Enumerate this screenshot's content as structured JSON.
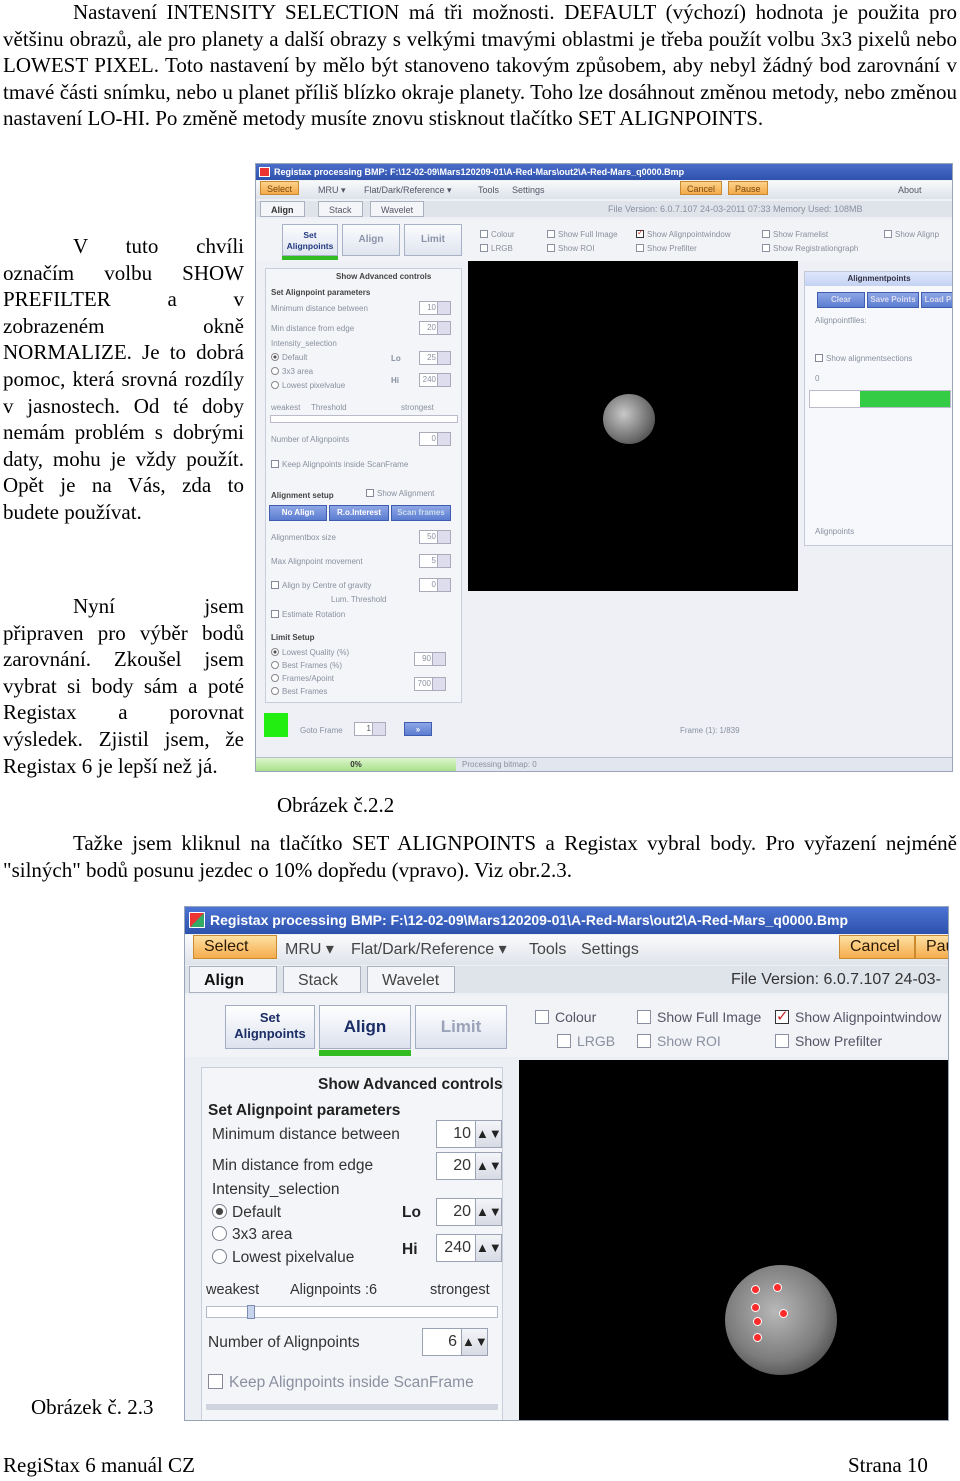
{
  "document": {
    "para1": "Nastavení INTENSITY SELECTION má tři možnosti. DEFAULT (výchozí) hodnota je použita pro většinu obrazů, ale pro planety a další obrazy s velkými tmavými oblastmi je třeba použít volbu 3x3 pixelů nebo LOWEST PIXEL. Toto nastavení by mělo být stanoveno takovým způsobem, aby nebyl žádný bod zarovnání v tmavé části snímku, nebo u planet příliš blízko okraje planety. Toho lze dosáhnout změnou metody, nebo změnou nastavení LO-HI. Po změně metody musíte znovu stisknout tlačítko SET ALIGNPOINTS.",
    "para2": "V tuto chvíli označím volbu SHOW PREFILTER a v zobrazeném okně NORMALIZE. Je to dobrá pomoc, která srovná rozdíly v jasnostech. Od té doby nemám problém s dobrými daty, mohu je vždy použít. Opět je na Vás, zda to budete používat.",
    "para3": "Nyní jsem připraven pro výběr bodů zarovnání. Zkoušel jsem vybrat si body sám a poté Registax a porovnat výsledek. Zjistil jsem, že Registax 6 je lepší než já.",
    "caption1": "Obrázek č.2.2",
    "para4": "Tažke jsem kliknul na tlačítko SET ALIGNPOINTS a Registax vybral body. Pro vyřazení nejméně \"silných\" bodů posunu jezdec o 10% dopředu (vpravo). Viz obr.2.3.",
    "caption2": "Obrázek č. 2.3",
    "footer_left": "RegiStax 6 manuál CZ",
    "footer_right": "Strana 10"
  },
  "shot1": {
    "title": "Registax processing BMP: F:\\12-02-09\\Mars120209-01\\A-Red-Mars\\out2\\A-Red-Mars_q0000.Bmp",
    "menu": {
      "select": "Select",
      "mru": "MRU ▾",
      "flat": "Flat/Dark/Reference ▾",
      "tools": "Tools",
      "settings": "Settings",
      "cancel": "Cancel",
      "pause": "Pause",
      "about": "About"
    },
    "tabs": {
      "align": "Align",
      "stack": "Stack",
      "wavelet": "Wavelet"
    },
    "info": "File Version: 6.0.7.107    24-03-2011 07:33    Memory Used: 108MB",
    "buttons": {
      "set": "Set Alignpoints",
      "align": "Align",
      "limit": "Limit"
    },
    "checks": {
      "colour": "Colour",
      "lrgb": "LRGB",
      "full": "Show Full Image",
      "roi": "Show ROI",
      "apw": "Show Alignpointwindow",
      "prefilter": "Show Prefilter",
      "framelist": "Show Framelist",
      "reggraph": "Show Registrationgraph",
      "showalign": "Show Alignp"
    },
    "left": {
      "advanced": "Show Advanced controls",
      "params": "Set Alignpoint parameters",
      "mindist": "Minimum distance between",
      "mindist_v": "10",
      "minedge": "Min distance from edge",
      "minedge_v": "20",
      "intensity": "Intensity_selection",
      "def": "Default",
      "lo": "Lo",
      "lo_v": "25",
      "area": "3x3 area",
      "lowest": "Lowest pixelvalue",
      "hi": "Hi",
      "hi_v": "240",
      "weakest": "weakest",
      "threshold": "Threshold",
      "strongest": "strongest",
      "numap": "Number of Alignpoints",
      "numap_v": "0",
      "keep": "Keep Alignpoints inside ScanFrame",
      "asetup": "Alignment setup",
      "showalign": "Show Alignment",
      "noalign": "No Align",
      "roint": "R.o.Interest",
      "scan": "Scan frames",
      "boxsize": "Alignmentbox size",
      "boxsize_v": "50",
      "maxmove": "Max Alignpoint movement",
      "maxmove_v": "5",
      "cog": "Align by Centre of gravity",
      "cog_v": "0",
      "lum": "Lum. Threshold",
      "rot": "Estimate Rotation",
      "limit": "Limit Setup",
      "lq": "Lowest Quality (%)",
      "lq_v": "90",
      "bf": "Best Frames (%)",
      "fpa": "Frames/Apoint",
      "fpa_v": "700",
      "bfr": "Best Frames"
    },
    "right": {
      "header": "Alignmentpoints",
      "clear": "Clear",
      "save": "Save Points",
      "load": "Load P",
      "files": "Alignpointfiles:",
      "show": "Show alignmentsections",
      "zero": "0",
      "alignpoints": "Alignpoints"
    },
    "goto": "Goto Frame",
    "goto_v": "1",
    "frame": "Frame (1): 1/839",
    "progress": "0%",
    "status": "Processing bitmap: 0"
  },
  "shot2": {
    "title": "Registax processing BMP: F:\\12-02-09\\Mars120209-01\\A-Red-Mars\\out2\\A-Red-Mars_q0000.Bmp",
    "menu": {
      "select": "Select",
      "mru": "MRU ▾",
      "flat": "Flat/Dark/Reference ▾",
      "tools": "Tools",
      "settings": "Settings",
      "cancel": "Cancel",
      "pause": "Pau"
    },
    "tabs": {
      "align": "Align",
      "stack": "Stack",
      "wavelet": "Wavelet"
    },
    "info": "File Version: 6.0.7.107    24-03-",
    "buttons": {
      "set": "Set Alignpoints",
      "align": "Align",
      "limit": "Limit"
    },
    "checks": {
      "colour": "Colour",
      "lrgb": "LRGB",
      "full": "Show Full Image",
      "roi": "Show ROI",
      "apw": "Show Alignpointwindow",
      "prefilter": "Show Prefilter"
    },
    "left": {
      "advanced": "Show Advanced controls",
      "params": "Set Alignpoint parameters",
      "mindist": "Minimum distance between",
      "mindist_v": "10",
      "minedge": "Min distance from edge",
      "minedge_v": "20",
      "intensity": "Intensity_selection",
      "def": "Default",
      "lo": "Lo",
      "lo_v": "20",
      "area": "3x3 area",
      "lowest": "Lowest pixelvalue",
      "hi": "Hi",
      "hi_v": "240",
      "weakest": "weakest",
      "apcount": "Alignpoints :6",
      "strongest": "strongest",
      "numap": "Number of Alignpoints",
      "numap_v": "6",
      "keep": "Keep Alignpoints inside ScanFrame",
      "arrows": "▲▼"
    }
  }
}
